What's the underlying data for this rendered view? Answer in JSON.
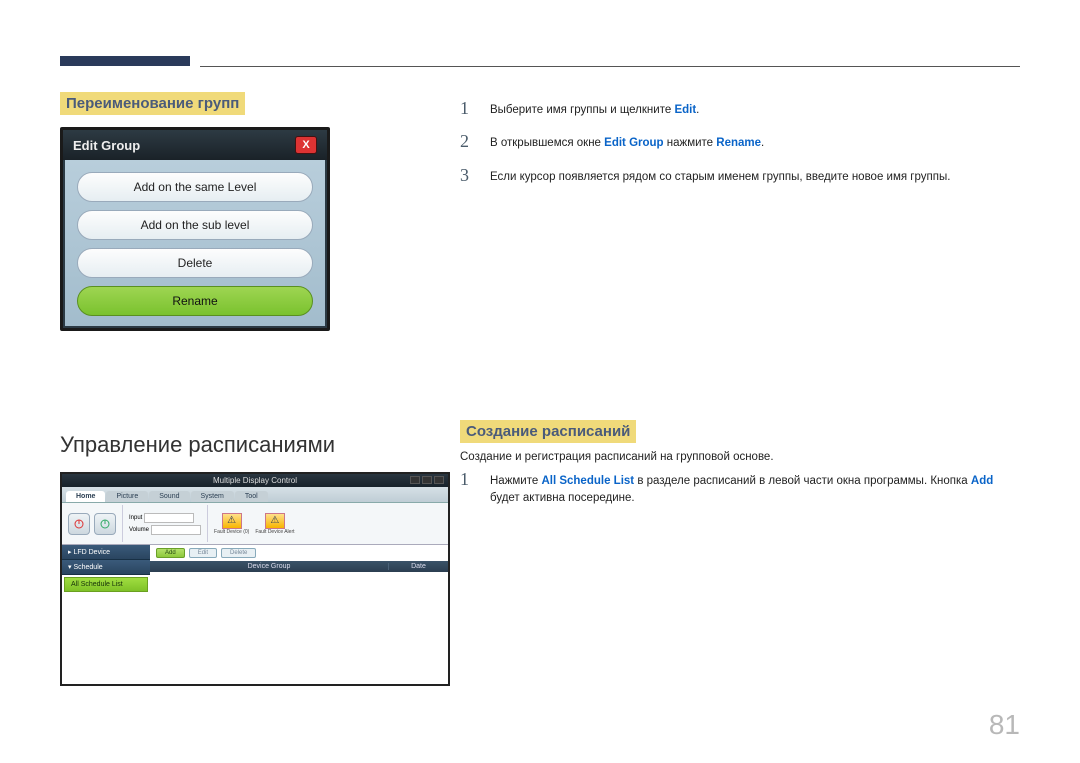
{
  "page_number": "81",
  "section1": {
    "heading": "Переименование групп",
    "dialog": {
      "title": "Edit Group",
      "options": [
        "Add on the same Level",
        "Add on the sub level",
        "Delete",
        "Rename"
      ]
    },
    "steps": [
      {
        "num": "1",
        "pre": "Выберите имя группы и щелкните ",
        "b1": "Edit",
        "post": "."
      },
      {
        "num": "2",
        "pre": "В открывшемся окне ",
        "b1": "Edit Group",
        "mid": " нажмите ",
        "b2": "Rename",
        "post": "."
      },
      {
        "num": "3",
        "pre": "Если курсор появляется рядом со старым именем группы, введите новое имя группы."
      }
    ]
  },
  "section2": {
    "heading": "Управление расписаниями",
    "subheading": "Создание расписаний",
    "intro": "Создание и регистрация расписаний на групповой основе.",
    "app": {
      "title": "Multiple Display Control",
      "tabs": [
        "Home",
        "Picture",
        "Sound",
        "System",
        "Tool"
      ],
      "ribbon": {
        "on": "On",
        "off": "Off",
        "input": "Input",
        "volume": "Volume",
        "fault1": "Fault Device (0)",
        "fault2": "Fault Device Alert"
      },
      "side": {
        "lfd": "▸ LFD Device",
        "schedule": "▾ Schedule",
        "all": "All Schedule List"
      },
      "actions": {
        "add": "Add",
        "edit": "Edit",
        "delete": "Delete"
      },
      "theader": {
        "group": "Device Group",
        "date": "Date"
      }
    },
    "step": {
      "num": "1",
      "pre": "Нажмите ",
      "b1": "All Schedule List",
      "mid": " в разделе расписаний в левой части окна программы. Кнопка ",
      "b2": "Add",
      "post": " будет активна посередине."
    }
  }
}
